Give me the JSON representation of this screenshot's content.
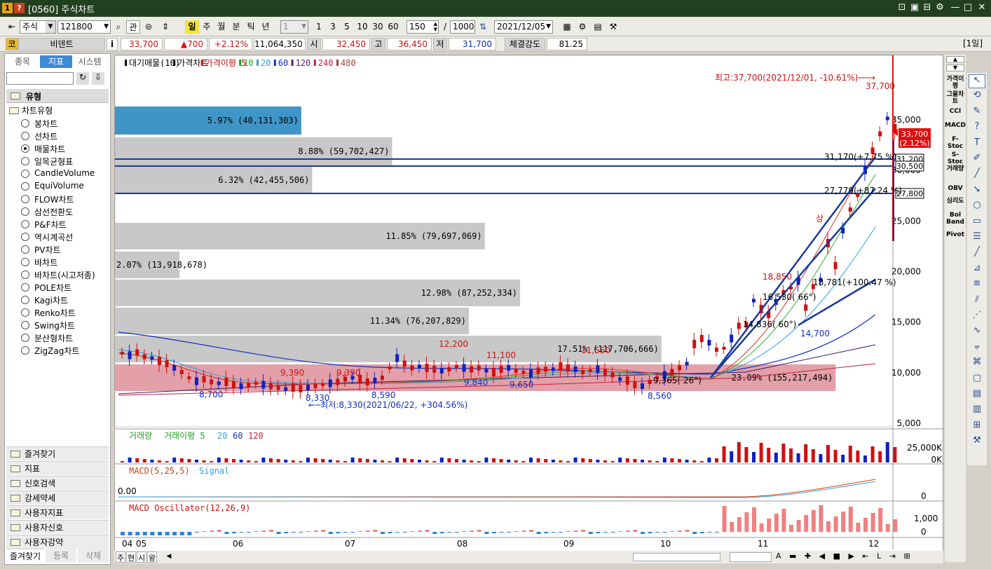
{
  "window": {
    "title": "[0560] 주식차트",
    "icon1": "1",
    "icon2": "?"
  },
  "toolbar": {
    "market": "주식",
    "code": "121800",
    "tsel": "관",
    "periods": [
      "일",
      "주",
      "월",
      "분",
      "틱",
      "년"
    ],
    "nsel": "1",
    "intervals": [
      "1",
      "3",
      "5",
      "10",
      "30",
      "60"
    ],
    "count": "150",
    "slash": "/",
    "total": "1000",
    "date": "2021/12/05"
  },
  "quote": {
    "name": "비덴트",
    "ko": "코",
    "price": "33,700",
    "change": "▲700",
    "rate": "+2.12%",
    "volume": "11,064,350",
    "open_label": "시",
    "open": "32,450",
    "high_label": "고",
    "high": "36,450",
    "low_label": "저",
    "low": "31,700",
    "strength_label": "체결강도",
    "strength": "81.25",
    "period_label": "[1일]"
  },
  "left": {
    "tabs": [
      "종목",
      "지표",
      "시스템"
    ],
    "group": "유형",
    "subgroup": "차트유형",
    "types": [
      "봉차트",
      "선차트",
      "매물차트",
      "일목균형표",
      "CandleVolume",
      "EquiVolume",
      "FLOW차트",
      "삼선전환도",
      "P&F차트",
      "역시계곡선",
      "PV차트",
      "바차트",
      "바차트(시고저종)",
      "POLE차트",
      "Kagi차트",
      "Renko차트",
      "Swing차트",
      "분산형차트",
      "ZigZag차트"
    ],
    "selected": "매물차트",
    "folders": [
      "즐겨찾기",
      "지표",
      "신호검색",
      "강세약세",
      "사용자지표",
      "사용자신호",
      "사용자강약"
    ],
    "bottom_tabs": [
      "즐겨찾기",
      "등록",
      "삭제"
    ]
  },
  "chart": {
    "legend": {
      "items": [
        "대기매물(10)",
        "가격차트",
        "가격이평 5",
        "10",
        "20",
        "60",
        "120",
        "240",
        "480"
      ]
    },
    "high_note": "최고:37,700(2021/12/01, -10.61%)──→",
    "low_note": "←─최저:8,330(2021/06/22, +304.56%)",
    "yaxis": [
      "35,000",
      "30,000",
      "25,000",
      "20,000",
      "15,000",
      "10,000",
      "5,000"
    ],
    "price_tag": [
      "33,700",
      "(2.12%)"
    ],
    "line_tags": [
      "31,200",
      "30,500",
      "27,800"
    ],
    "volume_profile": [
      {
        "label": "5.97% (40,131,303)",
        "pct": 5.97
      },
      {
        "label": "8.88% (59,702,427)",
        "pct": 8.88
      },
      {
        "label": "6.32% (42,455,506)",
        "pct": 6.32
      },
      {
        "label": "11.85% (79,697,069)",
        "pct": 11.85
      },
      {
        "label": "2.07% (13,918,678)",
        "pct": 2.07
      },
      {
        "label": "12.98% (87,252,334)",
        "pct": 12.98
      },
      {
        "label": "11.34% (76,207,829)",
        "pct": 11.34
      },
      {
        "label": "17.51% (117,706,666)",
        "pct": 17.51
      },
      {
        "label": "23.09% (155,217,494)",
        "pct": 23.09
      }
    ],
    "annotations": [
      "37,700",
      "18,850",
      "12,200",
      "11,100",
      "11,550",
      "9,390",
      "9,390",
      "8,700",
      "8,330",
      "8,590",
      "9,840",
      "9,650",
      "8,560",
      "14,700",
      "14,836( 60°)",
      "16,530( 66°)",
      "9,365( 26°)",
      "31,170(+7.75 %)",
      "27,779(+87.24 %)",
      "18,781(+100.47 %)",
      "상"
    ],
    "vol_legend": [
      "거래량",
      "거래이평 5",
      "20",
      "60",
      "120"
    ],
    "vol_axis": [
      "25,000K",
      "0K"
    ],
    "macd_legend": [
      "MACD(5,25,5)",
      "Signal"
    ],
    "macd_axis": [
      "0.00",
      "0"
    ],
    "osc_legend": "MACD Oscillator(12,26,9)",
    "osc_axis": [
      "1,000",
      "0"
    ],
    "xaxis": [
      "04",
      "05",
      "06",
      "07",
      "08",
      "09",
      "10",
      "11",
      "12"
    ]
  },
  "indicators": [
    "가격이평",
    "그물차트",
    "CCI",
    "MACD",
    "F-Stoc",
    "S-Stoc",
    "거래량",
    "OBV",
    "심리도",
    "Bol Band",
    "Pivot"
  ],
  "bottom": {
    "tabs": [
      "주",
      "현",
      "시",
      "왕"
    ]
  }
}
